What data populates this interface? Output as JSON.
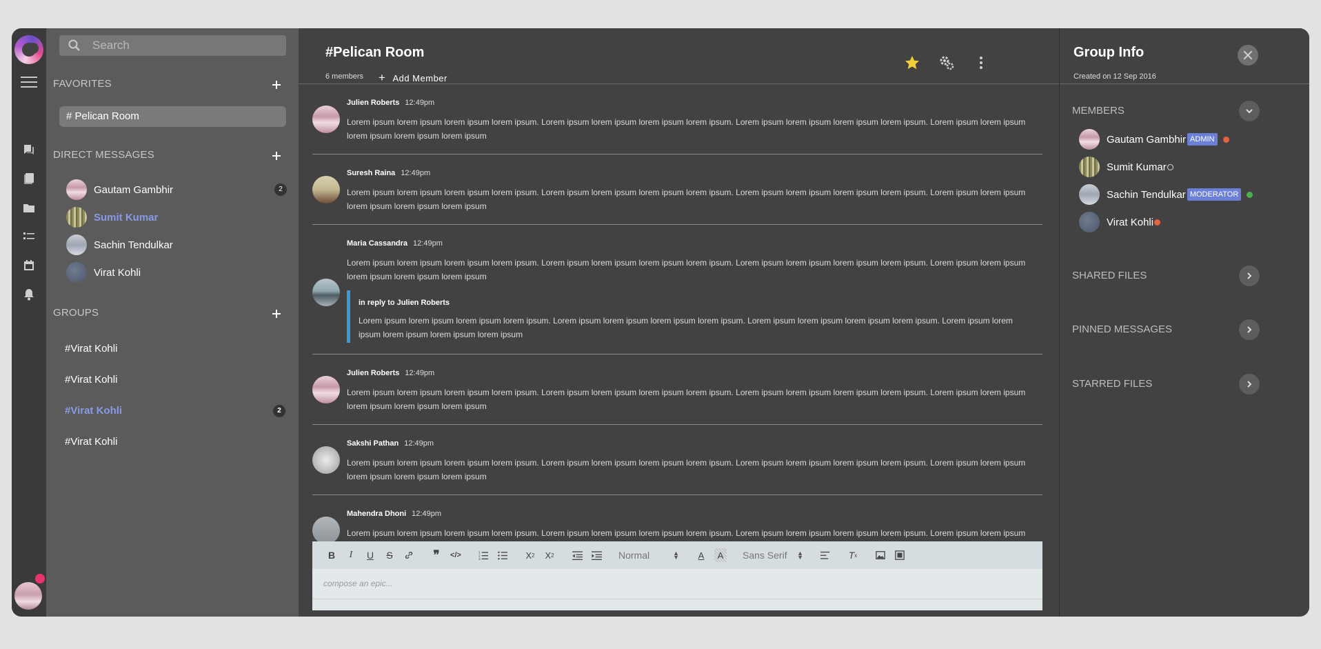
{
  "search": {
    "placeholder": "Search"
  },
  "sidebar": {
    "favorites_label": "FAVORITES",
    "favorites": [
      {
        "label": "# Pelican Room"
      }
    ],
    "direct_messages_label": "DIRECT MESSAGES",
    "direct_messages": [
      {
        "name": "Gautam Gambhir",
        "badge": "2"
      },
      {
        "name": "Sumit Kumar"
      },
      {
        "name": "Sachin Tendulkar"
      },
      {
        "name": "Virat Kohli"
      }
    ],
    "groups_label": "GROUPS",
    "groups": [
      {
        "name": "#Virat Kohli"
      },
      {
        "name": "#Virat Kohli"
      },
      {
        "name": "#Virat Kohli",
        "badge": "2"
      },
      {
        "name": "#Virat Kohli"
      }
    ]
  },
  "room": {
    "title": "#Pelican Room",
    "members": "6 members",
    "add_member": "Add Member"
  },
  "messages": [
    {
      "author": "Julien Roberts",
      "time": "12:49pm",
      "text": "Lorem ipsum lorem ipsum lorem ipsum lorem ipsum. Lorem ipsum lorem ipsum lorem ipsum lorem ipsum. Lorem ipsum lorem ipsum lorem ipsum lorem ipsum. Lorem ipsum lorem ipsum lorem ipsum lorem ipsum lorem ipsum"
    },
    {
      "author": "Suresh Raina",
      "time": "12:49pm",
      "text": "Lorem ipsum lorem ipsum lorem ipsum lorem ipsum. Lorem ipsum lorem ipsum lorem ipsum lorem ipsum. Lorem ipsum lorem ipsum lorem ipsum lorem ipsum. Lorem ipsum lorem ipsum lorem ipsum lorem ipsum lorem ipsum"
    },
    {
      "author": "Maria Cassandra",
      "time": "12:49pm",
      "text": "Lorem ipsum lorem ipsum lorem ipsum lorem ipsum. Lorem ipsum lorem ipsum lorem ipsum lorem ipsum. Lorem ipsum lorem ipsum lorem ipsum lorem ipsum. Lorem ipsum lorem ipsum lorem ipsum lorem ipsum lorem ipsum",
      "reply_to": "in reply to Julien Roberts",
      "reply_text": "Lorem ipsum lorem ipsum lorem ipsum lorem ipsum. Lorem ipsum lorem ipsum lorem ipsum lorem ipsum. Lorem ipsum lorem ipsum lorem ipsum lorem ipsum. Lorem ipsum lorem ipsum lorem ipsum lorem ipsum lorem ipsum"
    },
    {
      "author": "Julien Roberts",
      "time": "12:49pm",
      "text": "Lorem ipsum lorem ipsum lorem ipsum lorem ipsum. Lorem ipsum lorem ipsum lorem ipsum lorem ipsum. Lorem ipsum lorem ipsum lorem ipsum lorem ipsum. Lorem ipsum lorem ipsum lorem ipsum lorem ipsum lorem ipsum"
    },
    {
      "author": "Sakshi Pathan",
      "time": "12:49pm",
      "text": "Lorem ipsum lorem ipsum lorem ipsum lorem ipsum. Lorem ipsum lorem ipsum lorem ipsum lorem ipsum. Lorem ipsum lorem ipsum lorem ipsum lorem ipsum. Lorem ipsum lorem ipsum lorem ipsum lorem ipsum lorem ipsum"
    },
    {
      "author": "Mahendra Dhoni",
      "time": "12:49pm",
      "text": "Lorem ipsum lorem ipsum lorem ipsum lorem ipsum. Lorem ipsum lorem ipsum lorem ipsum lorem ipsum. Lorem ipsum lorem ipsum lorem ipsum lorem ipsum. Lorem ipsum lorem ipsum lorem ipsum lorem ipsum lorem ipsum"
    }
  ],
  "editor": {
    "size_select": "Normal",
    "font_select": "Sans Serif",
    "placeholder": "compose an epic..."
  },
  "info": {
    "title": "Group Info",
    "created": "Created on 12 Sep 2016",
    "members_label": "MEMBERS",
    "members": [
      {
        "name": "Gautam Gambhir",
        "role": "ADMIN",
        "status": "busy"
      },
      {
        "name": "Sumit Kumar",
        "status": "offline"
      },
      {
        "name": "Sachin Tendulkar",
        "role": "MODERATOR",
        "status": "online"
      },
      {
        "name": "Virat Kohli",
        "status": "busy"
      }
    ],
    "shared_files_label": "SHARED FILES",
    "pinned_messages_label": "PINNED MESSAGES",
    "starred_files_label": "STARRED FILES"
  },
  "colors": {
    "accent": "#8a9ae6",
    "badge": "#6b7fd7",
    "reply_bar": "#3a9ad9",
    "status_busy": "#e3633f",
    "status_online": "#4caf50",
    "notification": "#e8336d",
    "star": "#f2cf3a"
  }
}
